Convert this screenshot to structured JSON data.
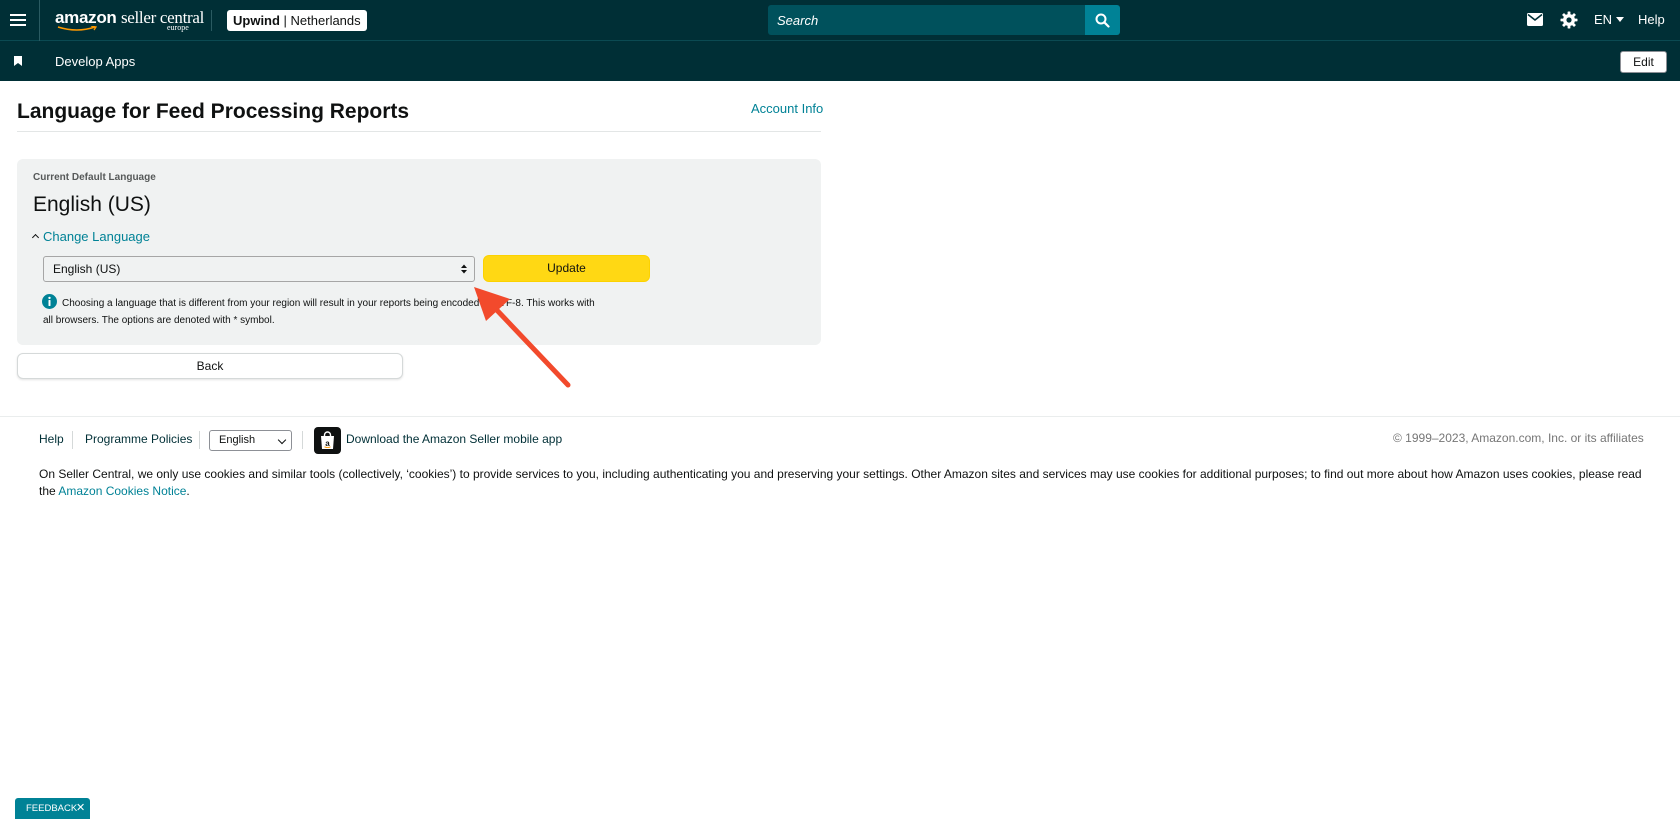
{
  "header": {
    "logo_main": "amazon",
    "logo_sub": "seller central",
    "logo_region": "europe",
    "account_store": "Upwind",
    "account_sep": " | ",
    "account_marketplace": "Netherlands",
    "search_placeholder": "Search",
    "language": "EN",
    "help": "Help",
    "icons": [
      "menu-icon",
      "search-icon",
      "mail-icon",
      "gear-icon"
    ]
  },
  "subbar": {
    "link": "Develop Apps",
    "edit": "Edit"
  },
  "page": {
    "title": "Language for Feed Processing Reports",
    "account_info": "Account Info"
  },
  "panel": {
    "current_label": "Current Default Language",
    "current_value": "English (US)",
    "change_language": "Change Language",
    "selected_option": "English (US)",
    "update": "Update",
    "info_text": "Choosing a language that is different from your region will result in your reports being encoded in UTF-8. This works with all browsers. The options are denoted with * symbol."
  },
  "back": "Back",
  "footer": {
    "help": "Help",
    "policies": "Programme Policies",
    "language_selected": "English",
    "app_link": "Download the Amazon Seller mobile app",
    "copyright": "© 1999–2023, Amazon.com, Inc. or its affiliates",
    "cookie_text": "On Seller Central, we only use cookies and similar tools (collectively, ‘cookies’) to provide services to you, including authenticating you and preserving your settings. Other Amazon sites and services may use cookies for additional purposes; to find out more about how Amazon uses cookies, please read the ",
    "cookie_link": "Amazon Cookies Notice",
    "cookie_end": "."
  },
  "feedback": {
    "label": "FEEDBACK",
    "close": "✕"
  },
  "colors": {
    "nav_bg": "#002f36",
    "search_bg": "#00515c",
    "teal": "#008296",
    "update_yellow": "#ffd814",
    "panel_bg": "#f0f2f2",
    "annotation_red": "#f24a2c"
  }
}
